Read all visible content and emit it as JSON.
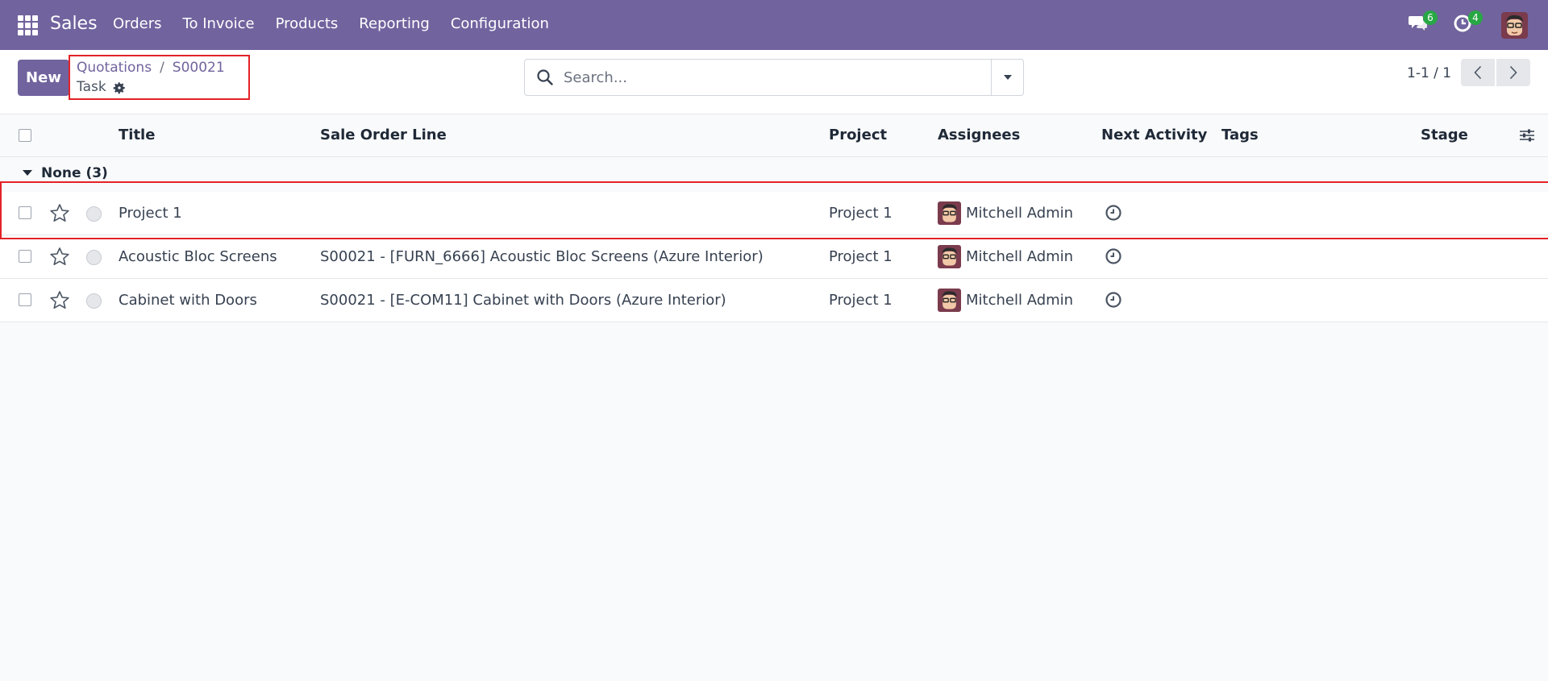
{
  "navbar": {
    "app_name": "Sales",
    "menu": [
      "Orders",
      "To Invoice",
      "Products",
      "Reporting",
      "Configuration"
    ],
    "messages_count": "6",
    "activities_count": "4",
    "accent_color": "#71639e"
  },
  "control_panel": {
    "new_label": "New",
    "breadcrumb": [
      "Quotations",
      "S00021"
    ],
    "breadcrumb_separator": "/",
    "current_view": "Task",
    "search_placeholder": "Search...",
    "pager": "1-1 / 1"
  },
  "list": {
    "columns": [
      "Title",
      "Sale Order Line",
      "Project",
      "Assignees",
      "Next Activity",
      "Tags",
      "Stage"
    ],
    "group": {
      "label": "None (3)"
    },
    "rows": [
      {
        "title": "Project 1",
        "sale_order_line": "",
        "project": "Project 1",
        "assignee": "Mitchell Admin"
      },
      {
        "title": "Acoustic Bloc Screens",
        "sale_order_line": "S00021 - [FURN_6666] Acoustic Bloc Screens (Azure Interior)",
        "project": "Project 1",
        "assignee": "Mitchell Admin"
      },
      {
        "title": "Cabinet with Doors",
        "sale_order_line": "S00021 - [E-COM11] Cabinet with Doors (Azure Interior)",
        "project": "Project 1",
        "assignee": "Mitchell Admin"
      }
    ]
  },
  "icons": {
    "apps": "apps-grid-icon",
    "messages": "chat-icon",
    "activities": "clock-icon",
    "settings": "gear-icon",
    "search": "search-icon",
    "favorite": "star-icon",
    "next_activity": "clock-icon"
  }
}
